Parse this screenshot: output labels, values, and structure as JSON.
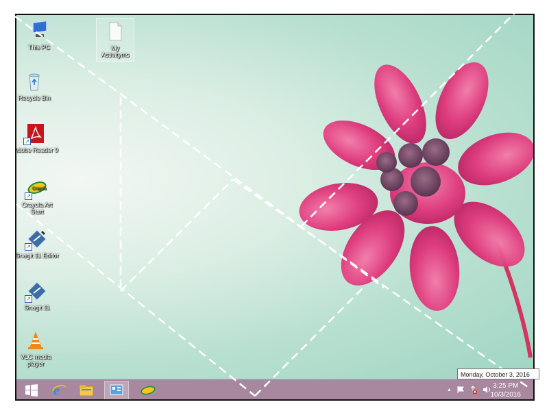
{
  "desktop": {
    "icons": [
      {
        "label": "This PC",
        "icon": "computer-icon"
      },
      {
        "label": "My Activityms",
        "icon": "document-icon"
      },
      {
        "label": "Recycle Bin",
        "icon": "recycle-bin-icon"
      },
      {
        "label": "Adobe Reader 9",
        "icon": "adobe-reader-icon"
      },
      {
        "label": "Crayola Art Start",
        "icon": "crayola-icon"
      },
      {
        "label": "Snagit 11 Editor",
        "icon": "snagit-editor-icon"
      },
      {
        "label": "Snagit 11",
        "icon": "snagit-icon"
      },
      {
        "label": "VLC media player",
        "icon": "vlc-icon"
      }
    ]
  },
  "taskbar": {
    "start": "start-icon",
    "pinned": [
      {
        "name": "Internet Explorer",
        "icon": "internet-explorer-icon"
      },
      {
        "name": "File Explorer",
        "icon": "file-explorer-icon"
      },
      {
        "name": "Control Panel",
        "icon": "control-panel-icon"
      },
      {
        "name": "Crayola",
        "icon": "crayola-taskbar-icon"
      }
    ],
    "tray": {
      "show_hidden": "▲",
      "time": "3:25 PM",
      "date": "10/3/2016"
    },
    "tooltip": "Monday, October 3, 2016"
  },
  "colors": {
    "taskbar": "#a8889e",
    "flower": "#e23a7c",
    "wallpaper": "#a6d8c6"
  }
}
